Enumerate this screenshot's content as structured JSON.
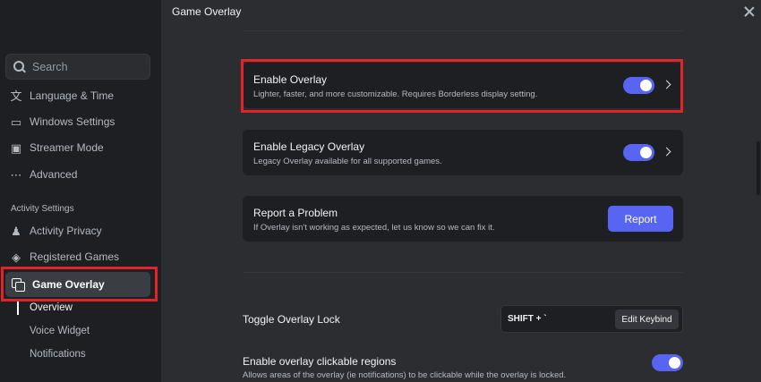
{
  "page": {
    "title": "Game Overlay"
  },
  "search": {
    "placeholder": "Search"
  },
  "sidebar": {
    "items_top": [
      {
        "label": "Language & Time",
        "icon": "language-icon"
      },
      {
        "label": "Windows Settings",
        "icon": "monitor-icon"
      },
      {
        "label": "Streamer Mode",
        "icon": "streamer-icon"
      },
      {
        "label": "Advanced",
        "icon": "more-dots-icon"
      }
    ],
    "section_activity": "Activity Settings",
    "items_activity": [
      {
        "label": "Activity Privacy",
        "icon": "person-icon"
      },
      {
        "label": "Registered Games",
        "icon": "gamepad-icon"
      }
    ],
    "active_item": {
      "label": "Game Overlay",
      "icon": "overlay-icon"
    },
    "sub_items": [
      "Overview",
      "Voice Widget",
      "Notifications"
    ]
  },
  "cards": {
    "enable_overlay": {
      "title": "Enable Overlay",
      "desc": "Lighter, faster, and more customizable. Requires Borderless display setting.",
      "toggle_on": true
    },
    "legacy_overlay": {
      "title": "Enable Legacy Overlay",
      "desc": "Legacy Overlay available for all supported games.",
      "toggle_on": true
    },
    "report": {
      "title": "Report a Problem",
      "desc": "If Overlay isn't working as expected, let us know so we can fix it.",
      "button": "Report"
    }
  },
  "overlay_lock": {
    "label": "Toggle Overlay Lock",
    "keybind": "SHIFT + `",
    "edit_button": "Edit Keybind"
  },
  "clickable_regions": {
    "label": "Enable overlay clickable regions",
    "desc": "Allows areas of the overlay (ie notifications) to be clickable while the overlay is locked.",
    "toggle_on": true
  },
  "colors": {
    "accent": "#5865f2",
    "highlight": "#e0242a"
  }
}
